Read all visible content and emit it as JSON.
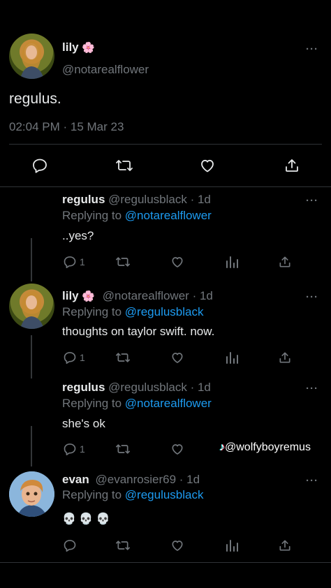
{
  "main_tweet": {
    "display_name": "lily",
    "name_emoji": "🌸",
    "handle": "@notarealflower",
    "text": "regulus.",
    "timestamp": "02:04 PM · 15 Mar 23",
    "more": "···"
  },
  "replies": [
    {
      "display_name": "regulus",
      "handle": "@regulusblack",
      "time": "· 1d",
      "replying_prefix": "Replying to ",
      "replying_to": "@notarealflower",
      "text": "..yes?",
      "reply_count": "1",
      "more": "···"
    },
    {
      "display_name": "lily",
      "name_emoji": "🌸",
      "handle": "@notarealflower",
      "time": "· 1d",
      "replying_prefix": "Replying to ",
      "replying_to": "@regulusblack",
      "text": "thoughts on taylor swift. now.",
      "reply_count": "1",
      "more": "···"
    },
    {
      "display_name": "regulus",
      "handle": "@regulusblack",
      "time": "· 1d",
      "replying_prefix": "Replying to ",
      "replying_to": "@notarealflower",
      "text": "she's ok",
      "reply_count": "1",
      "more": "···"
    },
    {
      "display_name": "evan",
      "handle": "@evanrosier69",
      "time": "· 1d",
      "replying_prefix": "Replying to ",
      "replying_to": "@regulusblack",
      "text": "💀 💀 💀",
      "more": "···"
    }
  ],
  "watermark": {
    "logo": "♪",
    "text": "@wolfyboyremus"
  },
  "colors": {
    "background": "#000000",
    "text": "#e7e9ea",
    "muted": "#71767b",
    "link": "#1d9bf0",
    "divider": "#2f3336"
  }
}
